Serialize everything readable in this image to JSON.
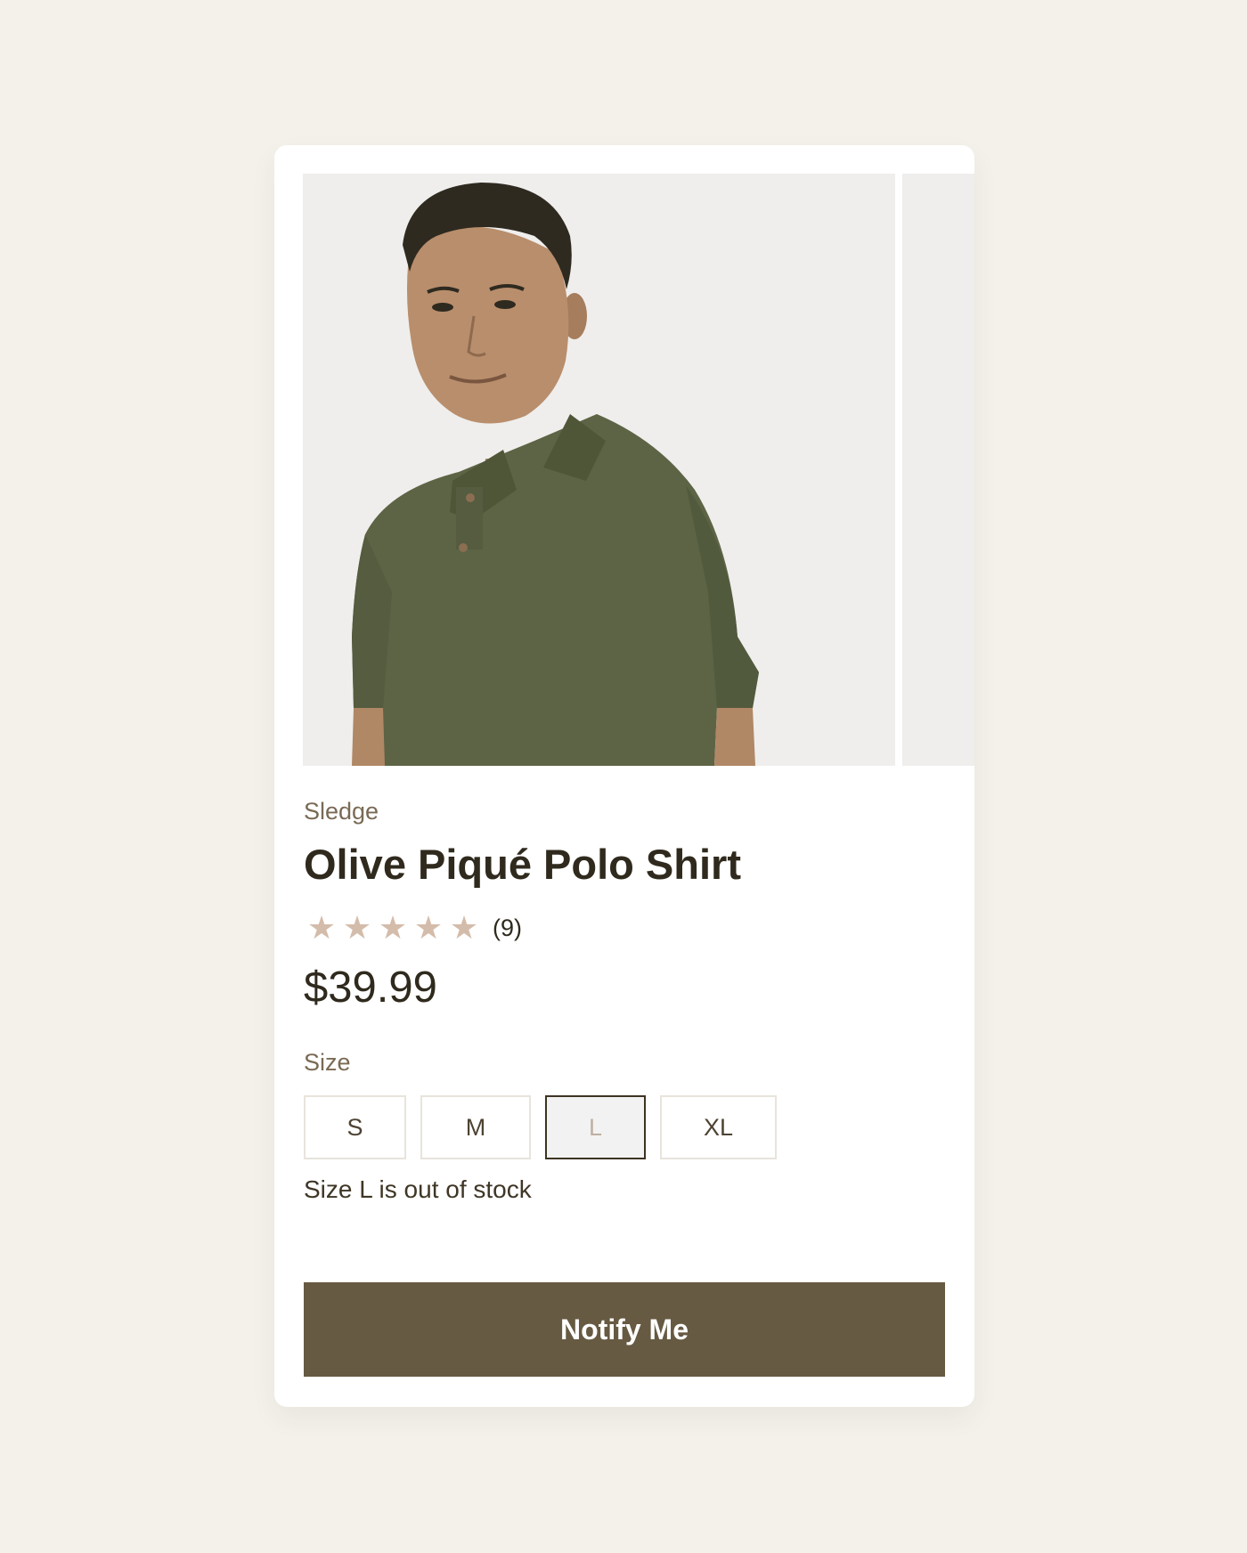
{
  "product": {
    "brand": "Sledge",
    "title": "Olive Piqué Polo Shirt",
    "rating": 5,
    "rating_max": 5,
    "review_count": "(9)",
    "price": "$39.99",
    "image_icon": "product-photo-man-olive-polo"
  },
  "size": {
    "label": "Size",
    "options": [
      "S",
      "M",
      "L",
      "XL"
    ],
    "selected": "L",
    "message": "Size L is out of stock"
  },
  "actions": {
    "notify_label": "Notify Me"
  },
  "colors": {
    "page_background": "#f3f1ea",
    "accent": "#675a42",
    "star": "#d4bcaa",
    "shirt": "#5d6445"
  }
}
